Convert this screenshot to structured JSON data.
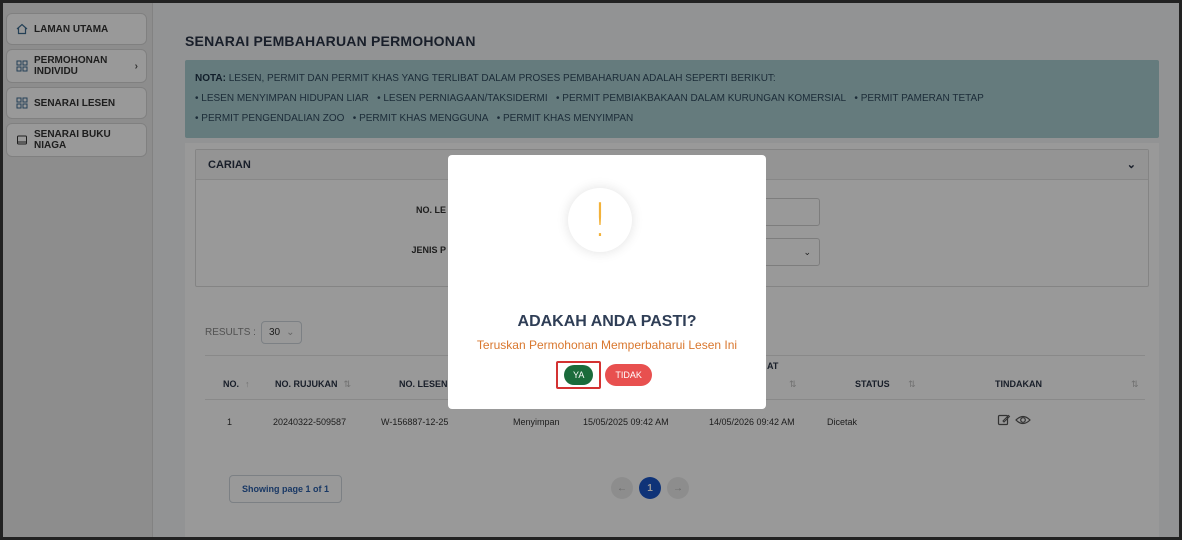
{
  "sidebar": {
    "items": [
      {
        "label": "LAMAN UTAMA",
        "icon": "home-icon"
      },
      {
        "label": "PERMOHONAN INDIVIDU",
        "icon": "grid-icon",
        "has_chevron": true
      },
      {
        "label": "SENARAI LESEN",
        "icon": "grid-icon"
      },
      {
        "label": "SENARAI BUKU NIAGA",
        "icon": "book-icon"
      }
    ],
    "chevron": "›"
  },
  "page": {
    "title": "SENARAI PEMBAHARUAN PERMOHONAN",
    "note_label": "NOTA:",
    "note_intro": "LESEN, PERMIT DAN PERMIT KHAS YANG TERLIBAT DALAM PROSES PEMBAHARUAN ADALAH SEPERTI BERIKUT:",
    "note_items": [
      "LESEN MENYIMPAN HIDUPAN LIAR",
      "LESEN PERNIAGAAN/TAKSIDERMI",
      "PERMIT PEMBIAKBAKAAN DALAM KURUNGAN KOMERSIAL",
      "PERMIT PAMERAN TETAP",
      "PERMIT PENGENDALIAN ZOO",
      "PERMIT KHAS MENGGUNA",
      "PERMIT KHAS MENYIMPAN"
    ]
  },
  "search": {
    "title": "CARIAN",
    "field1_label": "NO. LE",
    "field2_label": "JENIS P",
    "chevron": "⌄"
  },
  "results": {
    "label": "RESULTS :",
    "value": "30"
  },
  "table": {
    "headers": {
      "no": "NO.",
      "rujukan": "NO. RUJUKAN",
      "lesen": "NO. LESEN",
      "tarikh_tamat_partial": "AT",
      "status": "STATUS",
      "tindakan": "TINDAKAN"
    },
    "rows": [
      {
        "no": "1",
        "rujukan": "20240322-509587",
        "lesen": "W-156887-12-25",
        "jenis": "Menyimpan",
        "tarikh_mula": "15/05/2025 09:42 AM",
        "tarikh_tamat": "14/05/2026 09:42 AM",
        "status": "Dicetak"
      }
    ]
  },
  "pagination": {
    "showing": "Showing page 1 of 1",
    "prev": "←",
    "current": "1",
    "next": "→"
  },
  "modal": {
    "icon": "!",
    "title": "ADAKAH ANDA PASTI?",
    "text": "Teruskan Permohonan Memperbaharui Lesen Ini",
    "yes_label": "YA",
    "no_label": "TIDAK"
  },
  "colors": {
    "note_bg": "#a9cdd1",
    "warning": "#f3b23a",
    "yes_button": "#1a6b3b",
    "no_button": "#e8504f",
    "modal_text": "#d9772e",
    "page_active": "#1a56c9"
  }
}
